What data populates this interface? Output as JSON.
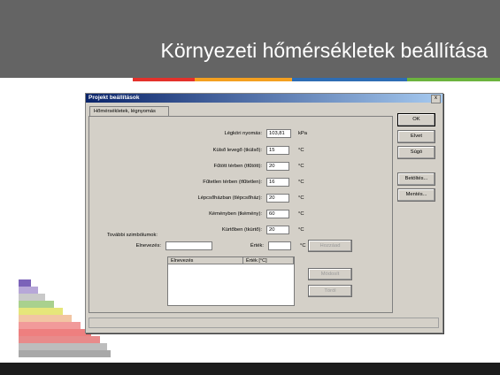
{
  "slide": {
    "title": "Környezeti hőmérsékletek beállítása",
    "colors": {
      "header": "#646464",
      "accent_bars": [
        "#e4312b",
        "#f4a020",
        "#2e6db4",
        "#6cb33e"
      ]
    }
  },
  "dialog": {
    "title": "Projekt beállítások",
    "close_glyph": "x",
    "tab_label": "Hőmérsékletek, légnyomás",
    "fields": [
      {
        "label": "Légköri nyomás:",
        "value": "103,81",
        "unit": "kPa"
      },
      {
        "label": "Külső levegő (tkülső):",
        "value": "15",
        "unit": "°C"
      },
      {
        "label": "Fűtött térben (tfűtött):",
        "value": "20",
        "unit": "°C"
      },
      {
        "label": "Fűtetlen térben (tfűtetlen):",
        "value": "16",
        "unit": "°C"
      },
      {
        "label": "Lépcsőházban (tlépcsőház):",
        "value": "20",
        "unit": "°C"
      },
      {
        "label": "Kéményben (tkémény):",
        "value": "60",
        "unit": "°C"
      },
      {
        "label": "Kürtőben (tkürtő):",
        "value": "20",
        "unit": "°C"
      }
    ],
    "extra_section": {
      "heading": "További szimbólumok:",
      "name_label": "Elnevezés:",
      "name_value": "",
      "value_label": "Érték:",
      "value_value": "",
      "value_unit": "°C",
      "add_button": "Hozzáad",
      "modify_button": "Módosít",
      "delete_button": "Töröl",
      "list_columns": [
        "Elnevezés",
        "Érték [°C]"
      ]
    },
    "side_buttons": {
      "ok": "OK",
      "cancel": "Elvet",
      "help": "Súgó",
      "load": "Betöltés...",
      "save": "Mentés..."
    }
  }
}
